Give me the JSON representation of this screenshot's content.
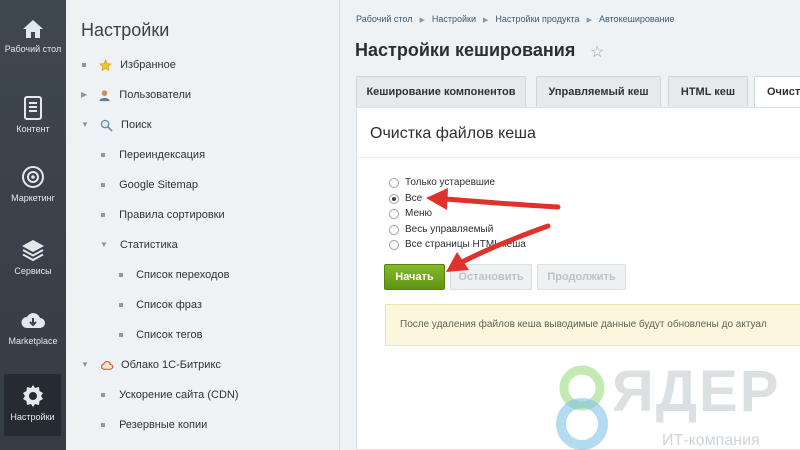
{
  "iconbar": {
    "items": [
      {
        "label": "Рабочий стол",
        "icon": "home-icon"
      },
      {
        "label": "Контент",
        "icon": "document-icon"
      },
      {
        "label": "Маркетинг",
        "icon": "target-icon"
      },
      {
        "label": "Сервисы",
        "icon": "layers-icon"
      },
      {
        "label": "Marketplace",
        "icon": "cloud-download-icon"
      },
      {
        "label": "Настройки",
        "icon": "gear-icon"
      }
    ]
  },
  "tree": {
    "title": "Настройки",
    "items": [
      {
        "label": "Избранное"
      },
      {
        "label": "Пользователи"
      },
      {
        "label": "Поиск"
      },
      {
        "label": "Переиндексация"
      },
      {
        "label": "Google Sitemap"
      },
      {
        "label": "Правила сортировки"
      },
      {
        "label": "Статистика"
      },
      {
        "label": "Список переходов"
      },
      {
        "label": "Список фраз"
      },
      {
        "label": "Список тегов"
      },
      {
        "label": "Облако 1С-Битрикс"
      },
      {
        "label": "Ускорение сайта (CDN)"
      },
      {
        "label": "Резервные копии"
      }
    ]
  },
  "breadcrumb": [
    "Рабочий стол",
    "Настройки",
    "Настройки продукта",
    "Автокеширование"
  ],
  "page_title": "Настройки кеширования",
  "tabs": [
    {
      "label": "Кеширование компонентов"
    },
    {
      "label": "Управляемый кеш"
    },
    {
      "label": "HTML кеш"
    },
    {
      "label": "Очист"
    }
  ],
  "panel": {
    "title": "Очистка файлов кеша",
    "options": [
      {
        "label": "Только устаревшие",
        "checked": false
      },
      {
        "label": "Все",
        "checked": true
      },
      {
        "label": "Меню",
        "checked": false
      },
      {
        "label": "Весь управляемый",
        "checked": false
      },
      {
        "label": "Все страницы HTML кеша",
        "checked": false
      }
    ],
    "buttons": {
      "start": "Начать",
      "stop": "Остановить",
      "continue": "Продолжить"
    },
    "notice": "После удаления файлов кеша выводимые данные будут обновлены до актуал"
  },
  "watermark": {
    "brand": "ЯДЕР",
    "sub": "ИТ-компания"
  },
  "colors": {
    "accent_green": "#6ea51c",
    "arrow_red": "#e0322c",
    "sidebar_dark": "#3b444c"
  }
}
